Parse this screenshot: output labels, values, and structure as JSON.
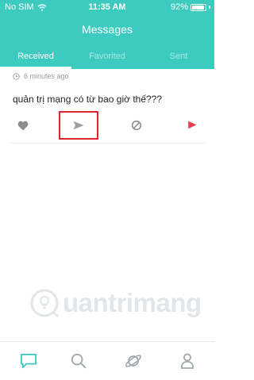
{
  "status_bar": {
    "carrier": "No SIM",
    "time": "11:35 AM",
    "battery": "92%",
    "battery_level": 0.92
  },
  "header": {
    "title": "Messages"
  },
  "tabs": [
    {
      "label": "Received",
      "active": true
    },
    {
      "label": "Favorited",
      "active": false
    },
    {
      "label": "Sent",
      "active": false
    }
  ],
  "message": {
    "timestamp": "6 minutes ago",
    "text": "quản trị mạng có từ bao giờ thế???"
  },
  "actions": [
    {
      "icon": "heart-icon",
      "color": "#8c8c8c"
    },
    {
      "icon": "send-icon",
      "color": "#9aa0a3"
    },
    {
      "icon": "block-icon",
      "color": "#8c8c8c"
    },
    {
      "icon": "flag-icon",
      "color": "#e8404b"
    }
  ],
  "watermark": {
    "text": "uantrimang"
  },
  "bottom_nav": [
    {
      "icon": "messages-icon",
      "active": true
    },
    {
      "icon": "search-icon",
      "active": false
    },
    {
      "icon": "planet-icon",
      "active": false
    },
    {
      "icon": "profile-icon",
      "active": false
    }
  ],
  "colors": {
    "accent": "#3ecbbf",
    "highlight": "#e0262b",
    "flag": "#e8404b",
    "inactive_icon": "#a0a9ad"
  }
}
